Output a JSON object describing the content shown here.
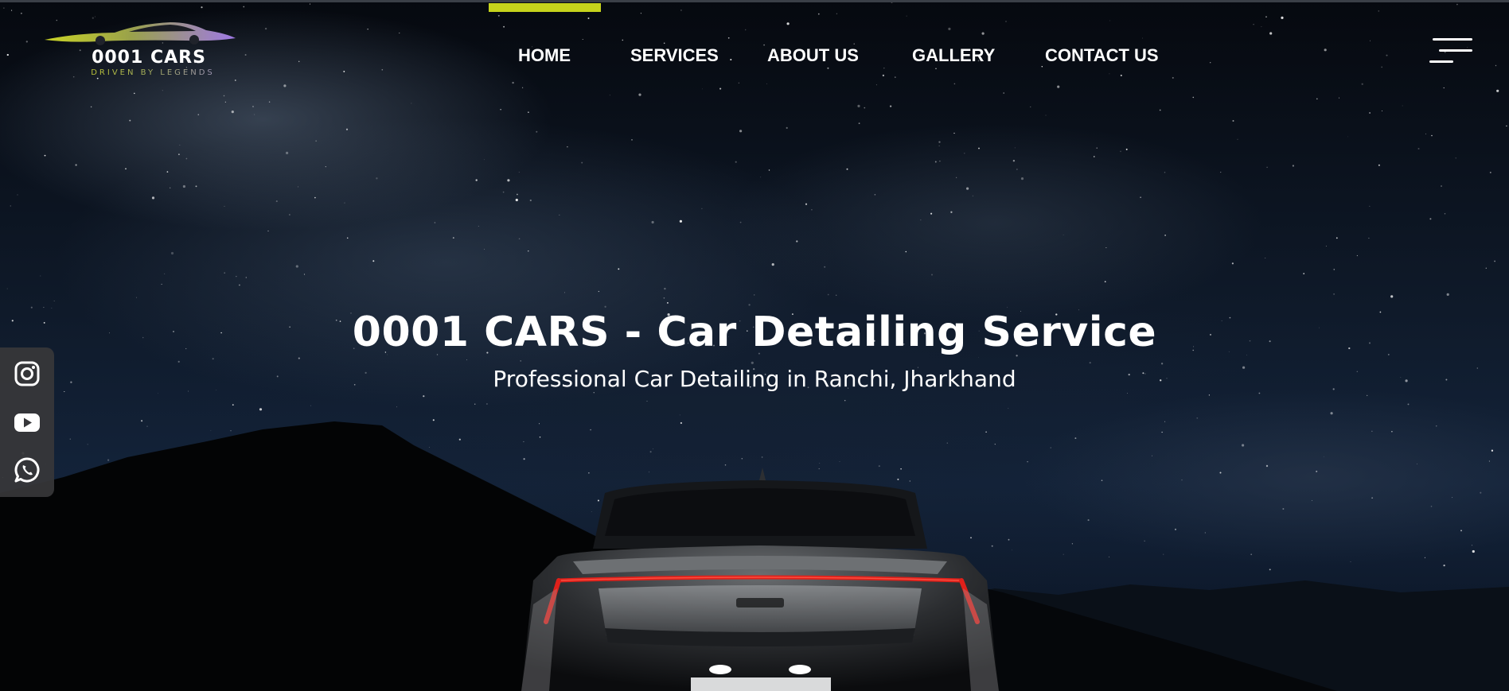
{
  "header": {
    "logo": {
      "name": "0001 CARS",
      "tagline": "DRIVEN BY LEGENDS"
    },
    "nav": [
      {
        "label": "HOME",
        "active": true
      },
      {
        "label": "SERVICES",
        "active": false
      },
      {
        "label": "ABOUT US",
        "active": false
      },
      {
        "label": "GALLERY",
        "active": false
      },
      {
        "label": "CONTACT US",
        "active": false
      }
    ],
    "menu_icon": "hamburger-menu-icon"
  },
  "hero": {
    "title": "0001 CARS - Car Detailing Service",
    "subtitle": "Professional Car Detailing in Ranchi, Jharkhand",
    "background_description_icon": "night-sky-car-photo"
  },
  "social": [
    {
      "icon": "instagram-icon"
    },
    {
      "icon": "youtube-icon"
    },
    {
      "icon": "whatsapp-icon"
    }
  ],
  "colors": {
    "accent": "#c6d31c",
    "nav_text": "#ffffff",
    "social_panel": "#37373a",
    "tail_light": "#e0201a"
  }
}
